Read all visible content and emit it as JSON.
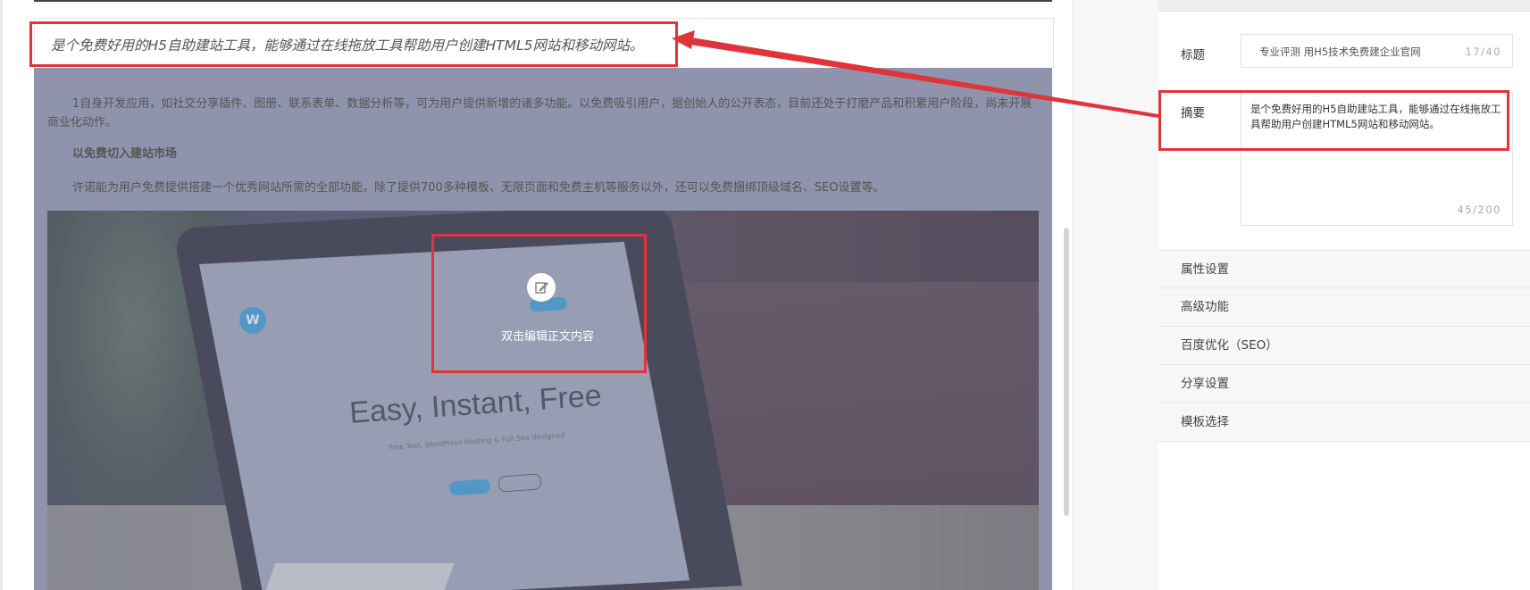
{
  "editor": {
    "summary_text": "是个免费好用的H5自助建站工具，能够通过在线拖放工具帮助用户创建HTML5网站和移动网站。",
    "paragraph1": "1自身开发应用，如社交分享插件、图册、联系表单、数据分析等，可为用户提供新增的诸多功能。以免费吸引用户，据创始人的公开表态，目前还处于打磨产品和积累用户阶段，尚未开展商业化动作。",
    "paragraph2": "以免费切入建站市场",
    "paragraph3": "许诺能为用户免费提供搭建一个优秀网站所需的全部功能，除了提供700多种模板、无限页面和免费主机等服务以外，还可以免费捆绑顶级域名、SEO设置等。",
    "edit_hint": "双击编辑正文内容",
    "edit_icon": "edit-icon",
    "image_headline": "Easy, Instant, Free",
    "image_subline": "Free Text, WordPress Hosting & Full Site designed",
    "image_logo": "W"
  },
  "panel": {
    "title_label": "标题",
    "title_value": "专业评测 用H5技术免费建企业官网",
    "title_count": "17/40",
    "abstract_label": "摘要",
    "abstract_value": "是个免费好用的H5自助建站工具，能够通过在线拖放工具帮助用户创建HTML5网站和移动网站。",
    "abstract_count": "45/200",
    "menu": [
      {
        "label": "属性设置"
      },
      {
        "label": "高级功能"
      },
      {
        "label": "百度优化（SEO）"
      },
      {
        "label": "分享设置"
      },
      {
        "label": "模板选择"
      }
    ]
  },
  "colors": {
    "annotation_red": "#e0343a",
    "overlay": "#8f93ac",
    "accent_blue": "#3aa0d6"
  }
}
